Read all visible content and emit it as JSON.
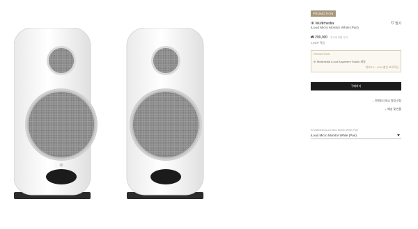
{
  "promotion_badge": "PROMOTION",
  "brand": "IK Multimedia",
  "wish_label": "찜 0",
  "product_name": "iLoud Micro Monitor White (Pair)",
  "price": "₩ 299,000",
  "price_note": "부가세 포함 가격",
  "points": "2,990P 적립",
  "promo_box": {
    "title": "PROMOTION",
    "line": "IK Multimedia iLoud Anywhere Studio 세일",
    "sub": "최대 15 ~ 40% 할인 프로모션"
  },
  "buy_button": "구매하기",
  "links": {
    "first": "인벤토리 재고 알림 신청",
    "second": "배송 및 반품"
  },
  "option": {
    "caption": "IK Multimedia iLoud Micro Monitor White (Pair)",
    "selected": "iLoud Micro Monitor White (Pair)"
  },
  "colors": {
    "accent": "#a8987a",
    "buy_button_bg": "#1c1c1c"
  },
  "icons": {
    "wish": "heart-icon",
    "link_arrow": "chevron-left-icon",
    "dropdown": "caret-down-icon"
  }
}
